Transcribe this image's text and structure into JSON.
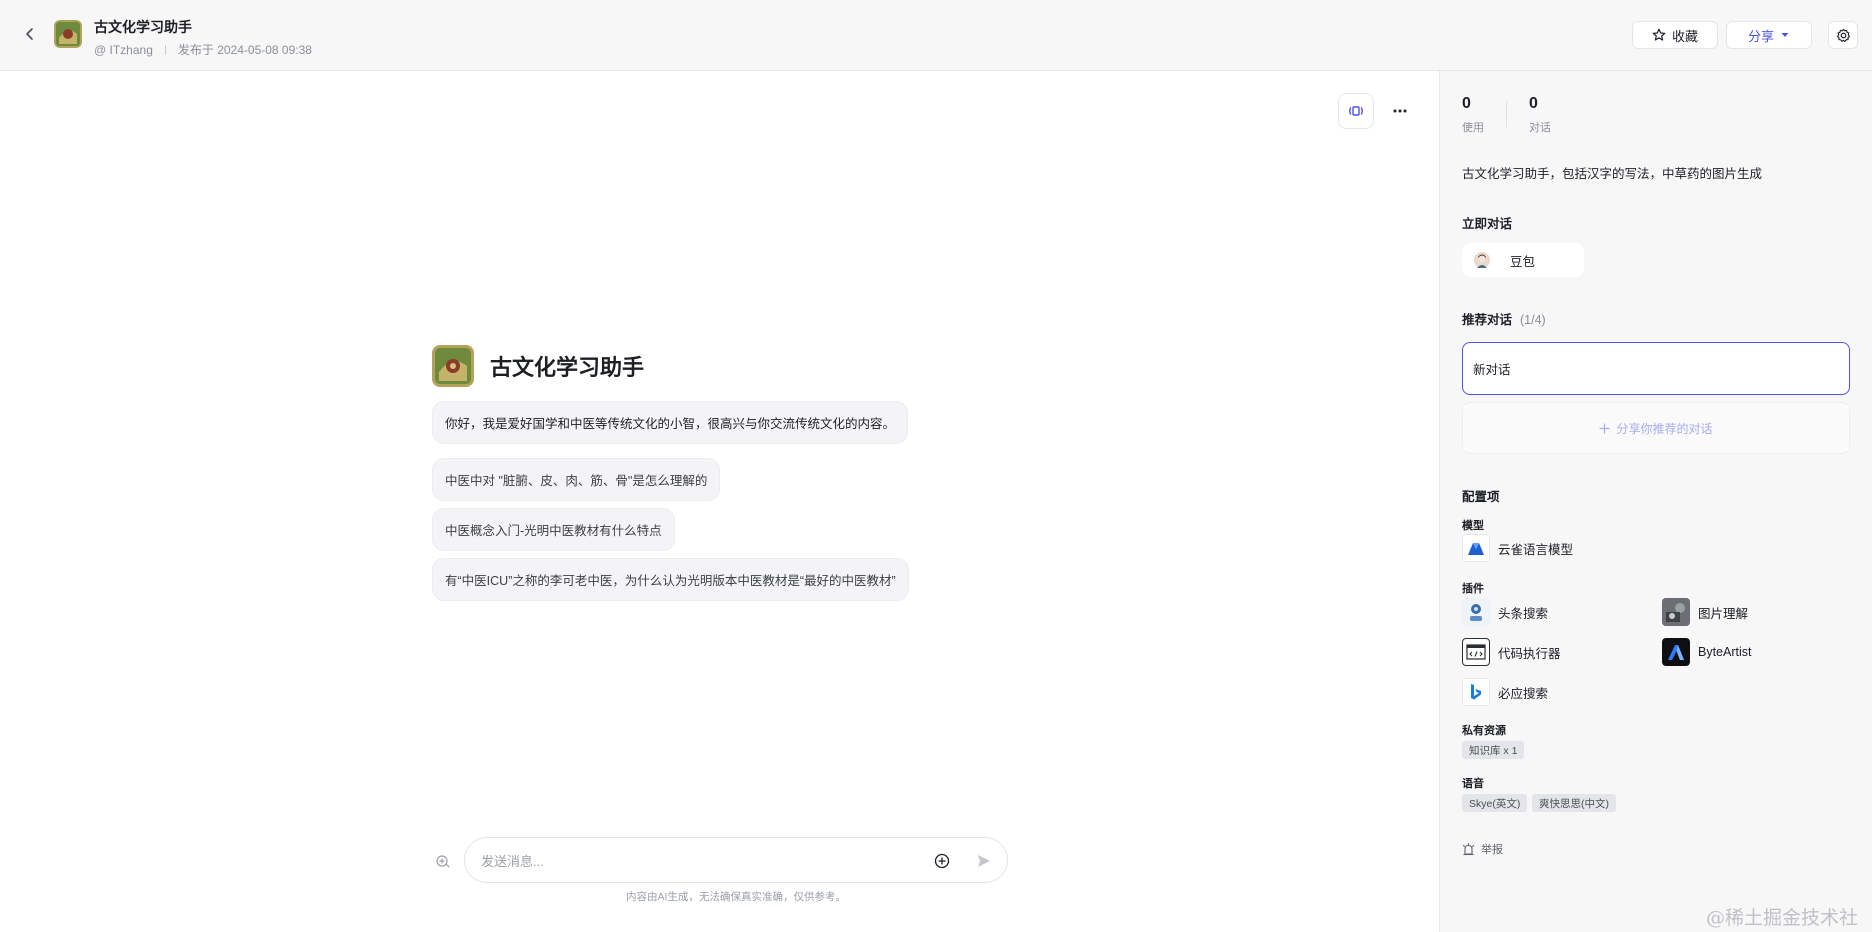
{
  "header": {
    "title": "古文化学习助手",
    "author": "@ ITzhang",
    "published": "发布于 2024-05-08 09:38",
    "favorite_label": "收藏",
    "share_label": "分享"
  },
  "main": {
    "bot_name": "古文化学习助手",
    "welcome": "你好，我是爱好国学和中医等传统文化的小智，很高兴与你交流传统文化的内容。",
    "suggestions": [
      "中医中对 \"脏腑、皮、肉、筋、骨\"是怎么理解的",
      "中医概念入门-光明中医教材有什么特点",
      "有“中医ICU”之称的李可老中医，为什么认为光明版本中医教材是“最好的中医教材”"
    ],
    "input_placeholder": "发送消息...",
    "disclaimer": "内容由AI生成，无法确保真实准确，仅供参考。"
  },
  "side": {
    "stats": [
      {
        "value": "0",
        "label": "使用"
      },
      {
        "value": "0",
        "label": "对话"
      }
    ],
    "description": "古文化学习助手，包括汉字的写法，中草药的图片生成",
    "chat_now_title": "立即对话",
    "chat_now_label": "豆包",
    "recommend_title": "推荐对话",
    "recommend_count": "(1/4)",
    "recommend_item": "新对话",
    "recommend_share": "分享你推荐的对话",
    "config_title": "配置项",
    "model_title": "模型",
    "model_name": "云雀语言模型",
    "plugins_title": "插件",
    "plugins": [
      "头条搜索",
      "图片理解",
      "代码执行器",
      "ByteArtist",
      "必应搜索"
    ],
    "private_title": "私有资源",
    "private_tag": "知识库 x 1",
    "voice_title": "语音",
    "voice_tags": [
      "Skye(英文)",
      "爽快思思(中文)"
    ],
    "report_label": "举报"
  },
  "watermark": "@稀土掘金技术社区",
  "colors": {
    "accent": "#4d53e8",
    "panel_bg": "#f7f7f8",
    "bubble_bg": "#f4f4f6"
  }
}
